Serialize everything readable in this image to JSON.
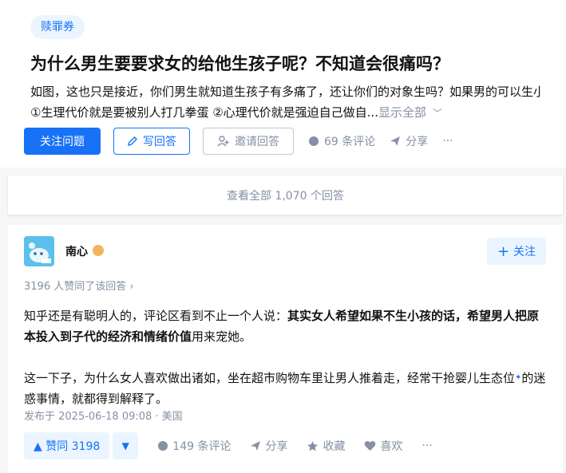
{
  "question": {
    "topic": "赎罪券",
    "title": "为什么男生要要求女的给他生孩子呢？不知道会很痛吗？",
    "detail_line1": "如图，这也只是接近，你们男生就知道生孩子有多痛了，还让你们的对象生吗？如果男的可以生小孩",
    "detail_line2": "①生理代价就是要被别人打几拳蛋 ②心理代价就是强迫自己做自...",
    "show_all": "显示全部",
    "follow_label": "关注问题",
    "write_label": "写回答",
    "invite_label": "邀请回答",
    "comments_label": "69 条评论",
    "share_label": "分享",
    "more_label": "···"
  },
  "view_all": "查看全部 1,070 个回答",
  "answer": {
    "author": "南心",
    "follow_label": "关注",
    "vote_info": "3196 人赞同了该回答 ›",
    "p1_plain": "知乎还是有聪明人的，评论区看到不止一个人说：",
    "p1_bold": "其实女人希望如果不生小孩的话，希望男人把原本投入到子代的经济和情绪价值",
    "p1_tail": "用来宠她。",
    "p2_text": "这一下子，为什么女人喜欢做出诸如，坐在超市购物车里让男人推着走，经常干抢婴儿生态位",
    "p2_tail": "的迷惑事情，就都得到解释了。",
    "time": "发布于 2025-06-18 09:08 · 美国",
    "vote_up": "▲ 赞同 3198",
    "vote_down": "▼",
    "comments": "149 条评论",
    "share": "分享",
    "collect": "收藏",
    "like": "喜欢",
    "more": "···"
  },
  "colors": {
    "brand": "#1772f6",
    "muted": "#8590a6",
    "bg": "#f6f6f6"
  }
}
